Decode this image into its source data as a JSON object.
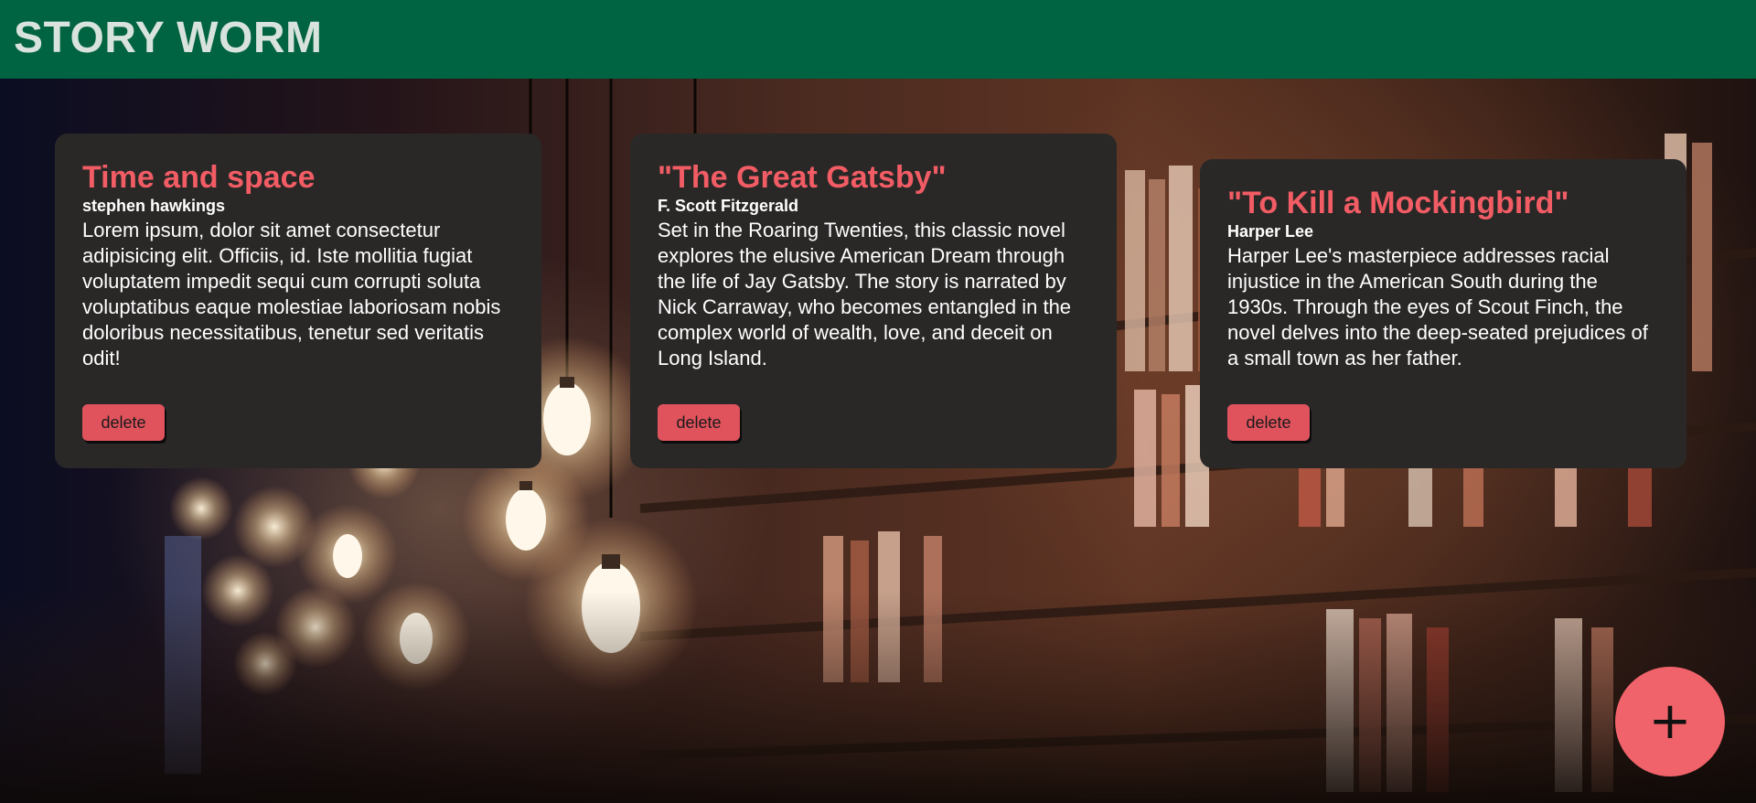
{
  "header": {
    "brand": "STORY WORM"
  },
  "books": [
    {
      "title": "Time and space",
      "author": "stephen hawkings",
      "description": "Lorem ipsum, dolor sit amet consectetur adipisicing elit. Officiis, id. Iste mollitia fugiat voluptatem impedit sequi cum corrupti soluta voluptatibus eaque molestiae laboriosam nobis doloribus necessitatibus, tenetur sed veritatis odit!",
      "delete_label": "delete"
    },
    {
      "title": "\"The Great Gatsby\"",
      "author": "F. Scott Fitzgerald",
      "description": "Set in the Roaring Twenties, this classic novel explores the elusive American Dream through the life of Jay Gatsby. The story is narrated by Nick Carraway, who becomes entangled in the complex world of wealth, love, and deceit on Long Island.",
      "delete_label": "delete"
    },
    {
      "title": "\"To Kill a Mockingbird\"",
      "author": "Harper Lee",
      "description": "Harper Lee's masterpiece addresses racial injustice in the American South during the 1930s. Through the eyes of Scout Finch, the novel delves into the deep-seated prejudices of a small town as her father.",
      "delete_label": "delete"
    }
  ],
  "add_button": {
    "label": "+",
    "icon": "plus-icon"
  },
  "colors": {
    "header_bg": "#006341",
    "card_bg": "#2a2827",
    "accent": "#f25c64",
    "delete_button": "#e0535d",
    "add_button": "#f0636a"
  }
}
